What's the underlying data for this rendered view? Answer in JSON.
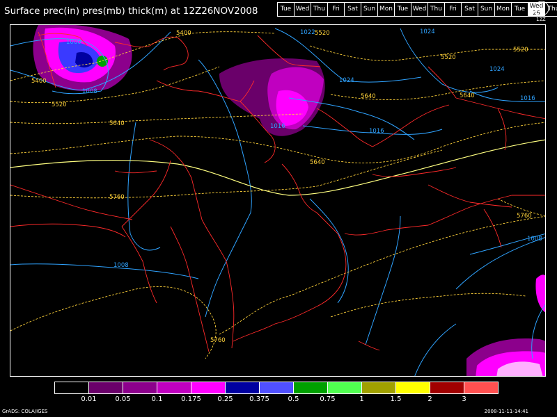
{
  "title": "Surface prec(in) pres(mb) thick(m) at 12Z26NOV2008",
  "days": [
    "Tue",
    "Wed",
    "Thu",
    "Fri",
    "Sat",
    "Sun",
    "Mon",
    "Tue",
    "Wed",
    "Thu",
    "Fri",
    "Sat",
    "Sun",
    "Mon",
    "Tue",
    "Wed",
    "Thu"
  ],
  "active_day_index": 15,
  "active_day_number": "26",
  "clock_label": "12Z",
  "legend": {
    "colors": [
      "#000000",
      "#6a006a",
      "#8c008c",
      "#c000c0",
      "#ff00ff",
      "#0000a0",
      "#5050ff",
      "#00a000",
      "#50ff50",
      "#a0a000",
      "#ffff00",
      "#a00000",
      "#ff5050"
    ],
    "labels": [
      "0.01",
      "0.05",
      "0.1",
      "0.175",
      "0.25",
      "0.375",
      "0.5",
      "0.75",
      "1",
      "1.5",
      "2",
      "3"
    ]
  },
  "isobars": [
    "1000",
    "1008",
    "1022",
    "1024",
    "1024",
    "1024",
    "1016",
    "1016",
    "1016",
    "1008",
    "1008"
  ],
  "thickness": [
    "5400",
    "5400",
    "5520",
    "5520",
    "5520",
    "5640",
    "5640",
    "5640",
    "5760",
    "5760",
    "5760"
  ],
  "colors": {
    "isobar": "#2fa3ff",
    "thickness": "#ffd23a",
    "coast": "#ff2a2a"
  },
  "footer_left": "GrADS: COLA/IGES",
  "footer_right": "2008-11-11-14:41"
}
